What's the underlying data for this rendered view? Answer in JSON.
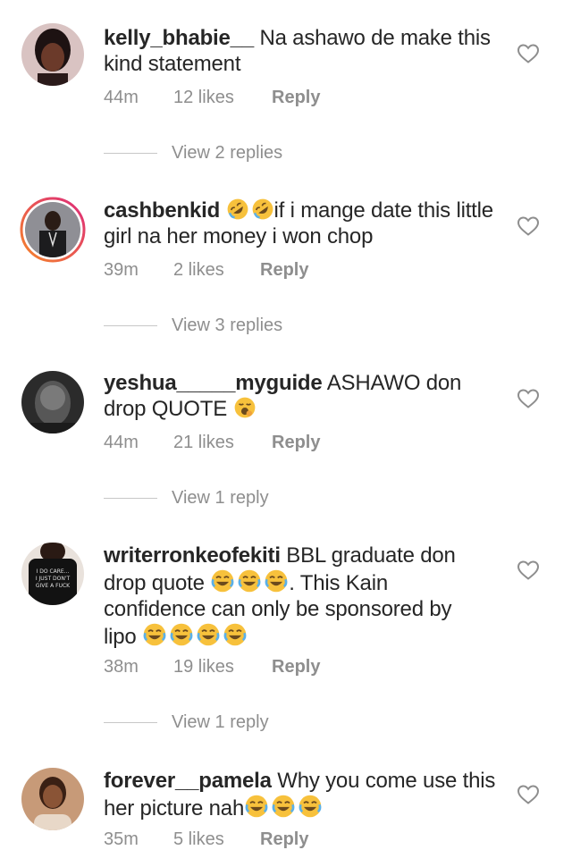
{
  "comments": [
    {
      "username": "kelly_bhabie__",
      "text": "Na ashawo de make this kind statement",
      "time": "44m",
      "likes": "12 likes",
      "reply": "Reply",
      "view_replies": "View 2 replies"
    },
    {
      "username": "cashbenkid",
      "text": "if i mange date this little girl na her money i won chop",
      "time": "39m",
      "likes": "2 likes",
      "reply": "Reply",
      "view_replies": "View 3 replies"
    },
    {
      "username": "yeshua_____myguide",
      "text": "ASHAWO don drop QUOTE",
      "time": "44m",
      "likes": "21 likes",
      "reply": "Reply",
      "view_replies": "View 1 reply"
    },
    {
      "username": "writerronkeofekiti",
      "text_a": "BBL graduate don drop quote",
      "text_b": ". This Kain confidence can only be sponsored by lipo",
      "time": "38m",
      "likes": "19 likes",
      "reply": "Reply",
      "view_replies": "View 1 reply",
      "shirt_text": "I DO CARE... I JUST DON'T GIVE A FUCK"
    },
    {
      "username": "forever__pamela",
      "text": "Why you come use this her picture nah",
      "time": "35m",
      "likes": "5 likes",
      "reply": "Reply"
    }
  ],
  "icons": {
    "like": "heart-outline-icon",
    "laugh_rolling": "rolling-on-floor-laughing-emoji",
    "tears_of_joy": "face-with-tears-of-joy-emoji",
    "yawn": "yawning-face-emoji"
  },
  "colors": {
    "text": "#262626",
    "muted": "#8e8e8e",
    "divider": "#c7c7c7",
    "emoji": "#f7c13c",
    "story_ring_start": "#f58529",
    "story_ring_end": "#dd2a7b"
  }
}
